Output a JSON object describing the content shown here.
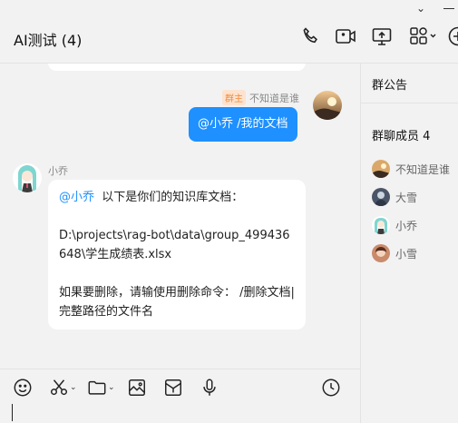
{
  "window": {
    "title": "AI测试 (4)"
  },
  "toolbar": {
    "icons": [
      "phone-icon",
      "video-call-icon",
      "screen-share-icon",
      "apps-grid-icon",
      "add-icon"
    ]
  },
  "messages": [
    {
      "sender": "不知道是谁",
      "badge": "群主",
      "text": "@小乔 /我的文档",
      "from_me": true
    },
    {
      "sender": "小乔",
      "mention": "@小乔",
      "line1": "以下是你们的知识库文档：",
      "line2": "D:\\projects\\rag-bot\\data\\group_499436648\\学生成绩表.xlsx",
      "line3": "如果要删除，请输使用删除命令： /删除文档|完整路径的文件名"
    }
  ],
  "sidebar": {
    "announcement_label": "群公告",
    "members_label": "群聊成员 4",
    "members": [
      {
        "name": "不知道是谁"
      },
      {
        "name": "大雪"
      },
      {
        "name": "小乔"
      },
      {
        "name": "小雪"
      }
    ]
  },
  "colors": {
    "accent": "#1e90ff",
    "badge_text": "#f08a3c",
    "badge_bg": "#fde3cf"
  },
  "input": {
    "value": "",
    "placeholder": ""
  }
}
